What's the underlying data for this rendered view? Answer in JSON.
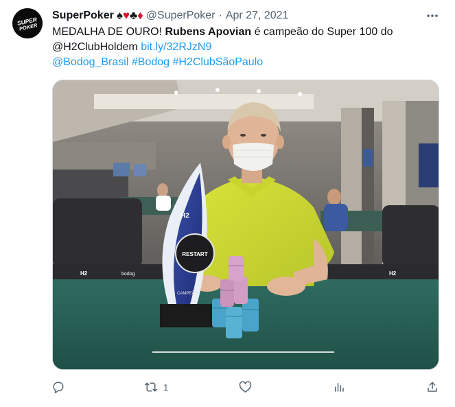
{
  "author": {
    "display_name": "SuperPoker",
    "handle": "@SuperPoker",
    "separator": "·",
    "date": "Apr 27, 2021",
    "avatar_text_top": "SUPER",
    "avatar_text_bottom": "POKER",
    "suits": [
      "♠",
      "♥",
      "♣",
      "♦"
    ]
  },
  "tweet": {
    "text_part1": "MEDALHA DE OURO! ",
    "text_bold": "Rubens Apovian",
    "text_part2": " é campeão do Super 100 do",
    "mention": "@H2ClubHoldem",
    "link": "bit.ly/32RJzN9",
    "hashtags": [
      "@Bodog_Brasil",
      "#Bodog",
      "#H2ClubSãoPaulo"
    ]
  },
  "media": {
    "trophy_brand": "H2",
    "trophy_badge": "RESTART",
    "trophy_base": "CAMPEÃO",
    "board_labels": [
      "H2",
      "bodog",
      "H2"
    ]
  },
  "actions": {
    "reply_count": "",
    "retweet_count": "1",
    "like_count": "",
    "views_count": ""
  },
  "colors": {
    "link": "#1d9bf0",
    "secondary_text": "#536471",
    "suit_red": "#d4142a"
  }
}
